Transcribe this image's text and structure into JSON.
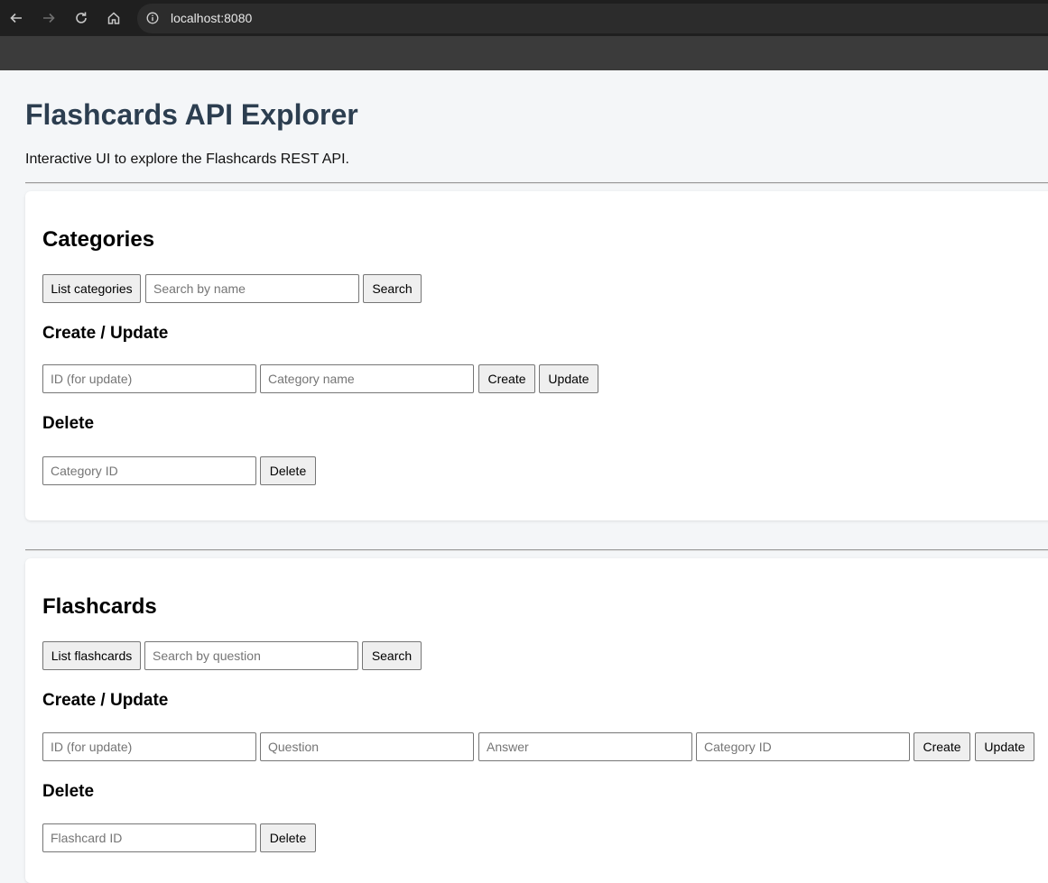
{
  "browser": {
    "url": "localhost:8080",
    "icons": [
      "back-icon",
      "forward-icon",
      "reload-icon",
      "home-icon",
      "site-info-icon"
    ]
  },
  "page": {
    "title": "Flashcards API Explorer",
    "subtitle": "Interactive UI to explore the Flashcards REST API."
  },
  "categories": {
    "heading": "Categories",
    "list_button": "List categories",
    "search_placeholder": "Search by name",
    "search_button": "Search",
    "create_update_heading": "Create / Update",
    "id_placeholder": "ID (for update)",
    "name_placeholder": "Category name",
    "create_button": "Create",
    "update_button": "Update",
    "delete_heading": "Delete",
    "delete_id_placeholder": "Category ID",
    "delete_button": "Delete"
  },
  "flashcards": {
    "heading": "Flashcards",
    "list_button": "List flashcards",
    "search_placeholder": "Search by question",
    "search_button": "Search",
    "create_update_heading": "Create / Update",
    "id_placeholder": "ID (for update)",
    "question_placeholder": "Question",
    "answer_placeholder": "Answer",
    "category_id_placeholder": "Category ID",
    "create_button": "Create",
    "update_button": "Update",
    "delete_heading": "Delete",
    "delete_id_placeholder": "Flashcard ID",
    "delete_button": "Delete"
  }
}
